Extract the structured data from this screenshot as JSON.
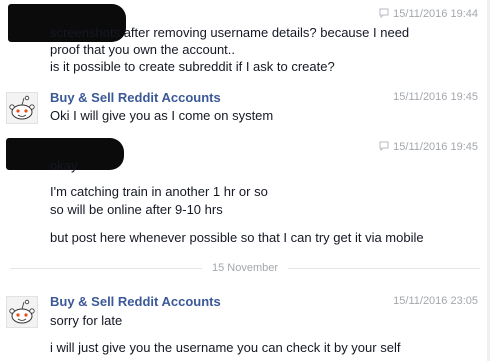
{
  "messages": [
    {
      "sender": "",
      "timestamp": "15/11/2016 19:44",
      "lines": [
        "screenshots after removing username details? because I need",
        "proof that you own the account..",
        "is it possible to create subreddit if I ask to create?"
      ]
    },
    {
      "sender": "Buy & Sell Reddit Accounts",
      "timestamp": "15/11/2016 19:45",
      "lines": [
        "Oki I will give you as I come on system"
      ]
    },
    {
      "sender": "",
      "timestamp": "15/11/2016 19:45",
      "lines": [
        "okay",
        "I'm catching train in another 1 hr or so",
        "so will be online after 9-10 hrs",
        "but post here whenever possible so that I can try get it via mobile"
      ]
    },
    {
      "sender": "Buy & Sell Reddit Accounts",
      "timestamp": "15/11/2016 23:05",
      "lines": [
        "sorry for late",
        "i will just give you the username you can check it by your self"
      ]
    }
  ],
  "day_divider": "15 November",
  "colors": {
    "sender": "#3b5998",
    "timestamp": "#a3a7ad",
    "redaction": "#0b0b0b"
  },
  "icons": {
    "timestamp": "chat-bubble-icon",
    "avatar": "reddit-alien-avatar-icon"
  }
}
